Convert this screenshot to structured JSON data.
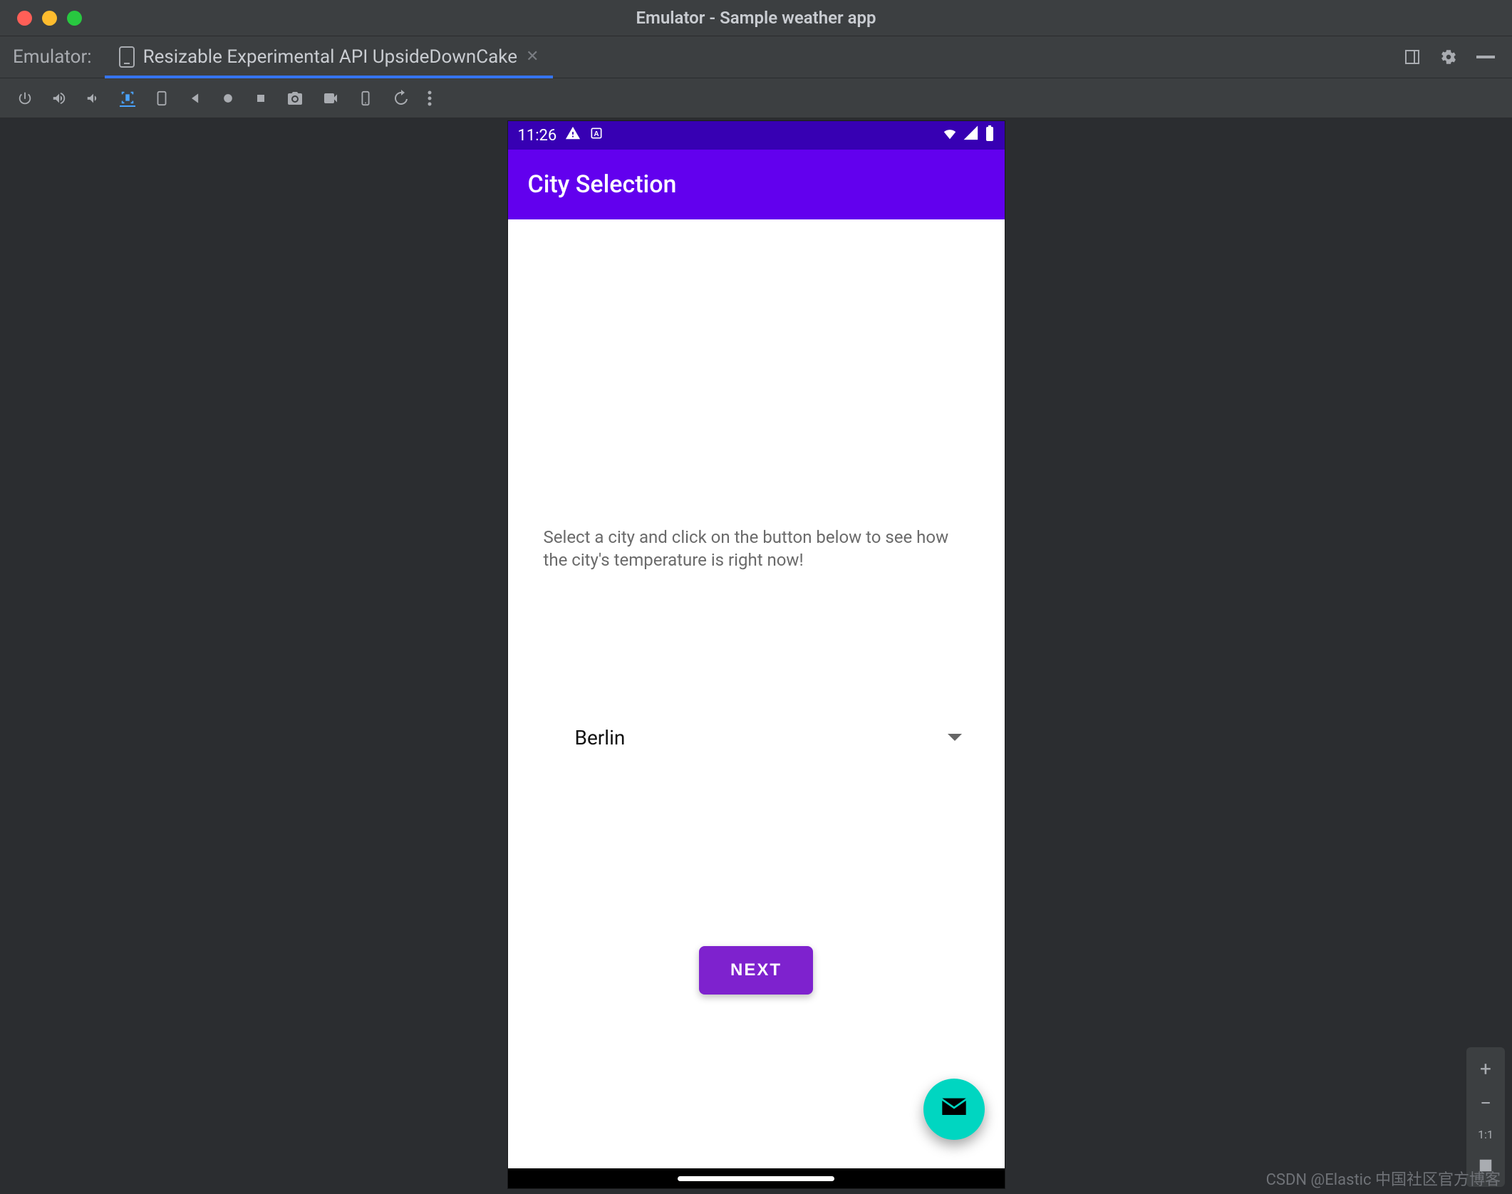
{
  "window": {
    "title": "Emulator - Sample weather app"
  },
  "tabstrip": {
    "label": "Emulator:",
    "active_tab": "Resizable Experimental API UpsideDownCake"
  },
  "toolbar_icons": [
    "power-icon",
    "volume-up-icon",
    "volume-down-icon",
    "rotate-left-icon",
    "rotate-right-icon",
    "back-icon",
    "home-icon",
    "overview-icon",
    "screenshot-icon",
    "record-icon",
    "device-select-icon",
    "snapshots-icon",
    "more-icon"
  ],
  "phone": {
    "status": {
      "time": "11:26"
    },
    "app_bar_title": "City Selection",
    "help_text": "Select a city and click on the button below to see how the city's temperature is right now!",
    "city_selected": "Berlin",
    "next_button": "NEXT"
  },
  "zoom": {
    "one_to_one": "1:1"
  },
  "watermark": "CSDN @Elastic 中国社区官方博客"
}
